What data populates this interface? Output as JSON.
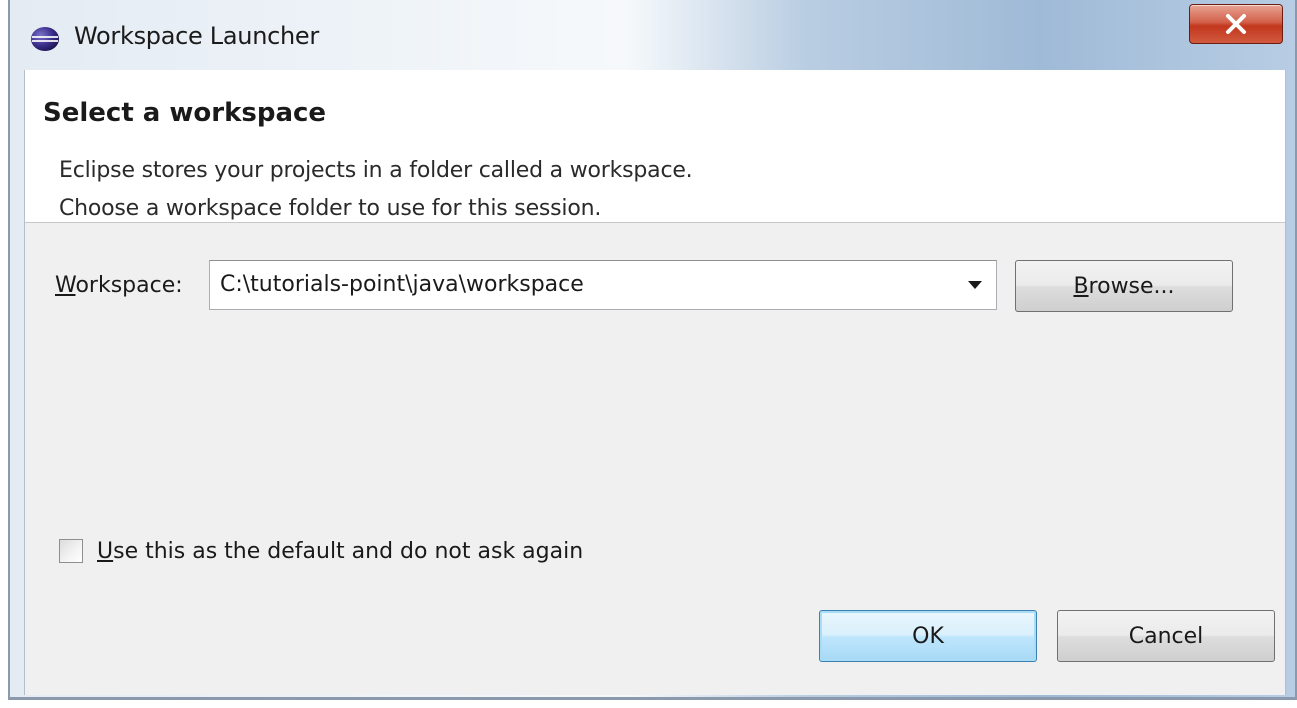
{
  "window": {
    "title": "Workspace Launcher",
    "close_glyph": "X",
    "icon": "eclipse-icon"
  },
  "banner": {
    "title": "Select a workspace",
    "message_line1": "Eclipse stores your projects in a folder called a workspace.",
    "message_line2": "Choose a workspace folder to use for this session."
  },
  "workspace": {
    "label_mnemonic": "W",
    "label_rest": "orkspace:",
    "value": "C:\\tutorials-point\\java\\workspace",
    "dropdown_icon": "chevron-down-icon"
  },
  "browse_button": {
    "mnemonic": "B",
    "rest": "rowse..."
  },
  "default_checkbox": {
    "mnemonic": "U",
    "rest": "se this as the default and do not ask again",
    "checked": false
  },
  "buttons": {
    "ok": "OK",
    "cancel": "Cancel"
  },
  "colors": {
    "close_button": "#c9452a",
    "ok_focus_border": "#3c7fb1",
    "dialog_background": "#f0f0f0",
    "banner_background": "#ffffff"
  }
}
